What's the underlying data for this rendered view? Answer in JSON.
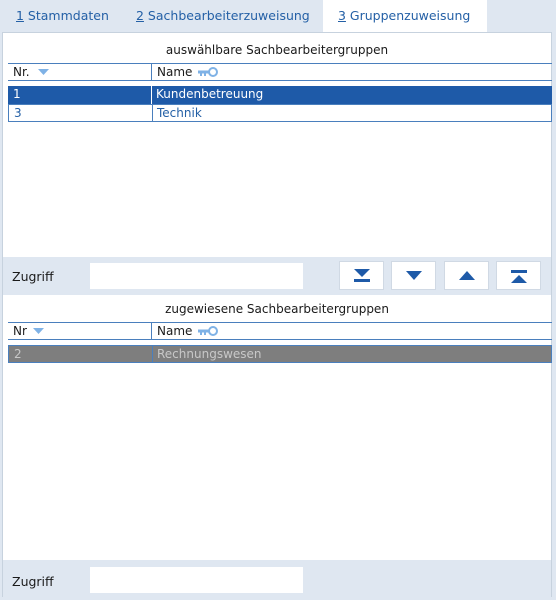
{
  "tabs": [
    {
      "num": "1",
      "label": " Stammdaten"
    },
    {
      "num": "2",
      "label": " Sachbearbeiterzuweisung"
    },
    {
      "num": "3",
      "label": " Gruppenzuweisung"
    }
  ],
  "available": {
    "title": "auswählbare Sachbearbeitergruppen",
    "columns": {
      "nr": "Nr.",
      "name": "Name"
    },
    "rows": [
      {
        "nr": "1",
        "name": "Kundenbetreuung"
      },
      {
        "nr": "3",
        "name": "Technik"
      }
    ]
  },
  "assigned": {
    "title": "zugewiesene Sachbearbeitergruppen",
    "columns": {
      "nr": "Nr",
      "name": "Name"
    },
    "rows": [
      {
        "nr": "2",
        "name": "Rechnungswesen"
      }
    ]
  },
  "filter_top": {
    "label": "Zugriff",
    "value": ""
  },
  "filter_bottom": {
    "label": "Zugriff",
    "value": ""
  },
  "buttons": [
    {
      "name": "move-all-down-button",
      "icon": "arrow-down-bar-icon"
    },
    {
      "name": "move-down-button",
      "icon": "arrow-down-icon"
    },
    {
      "name": "move-up-button",
      "icon": "arrow-up-icon"
    },
    {
      "name": "move-all-up-button",
      "icon": "arrow-up-bar-icon"
    }
  ],
  "colors": {
    "accent": "#1e5aa8",
    "link": "#2460a6",
    "toolbar": "#dfe7f1"
  }
}
